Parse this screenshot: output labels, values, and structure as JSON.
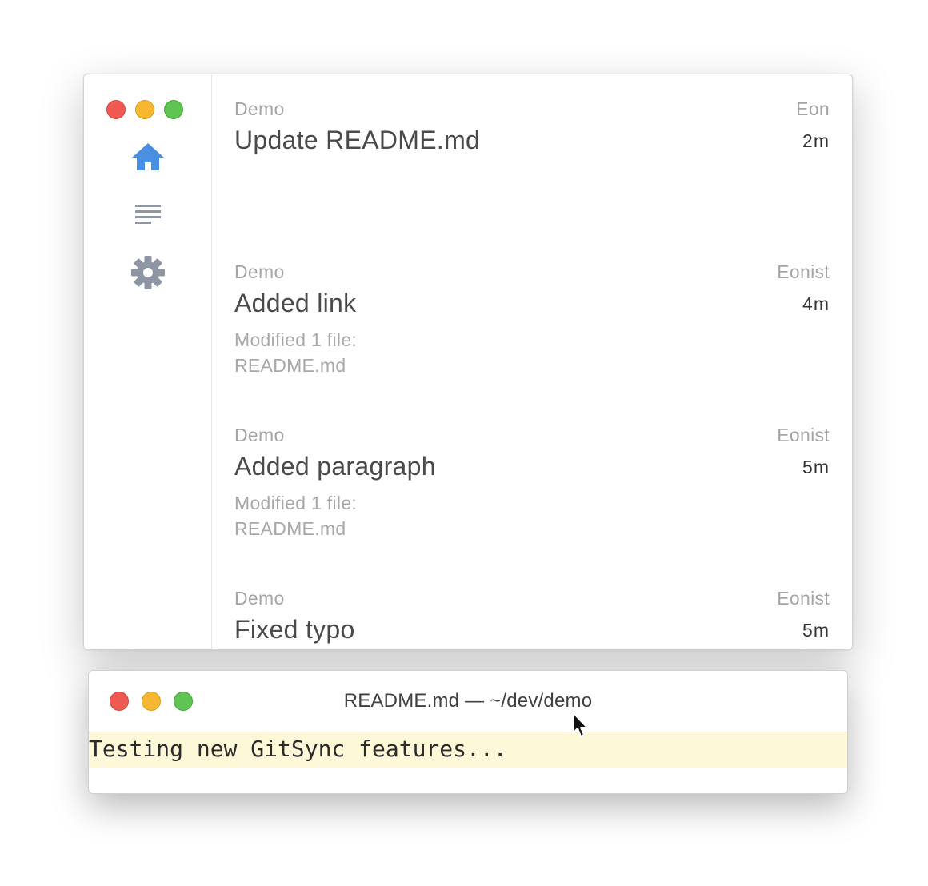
{
  "app": {
    "window_controls": {
      "close": "close-button",
      "minimize": "minimize-button",
      "zoom": "zoom-button"
    },
    "sidebar": {
      "items": [
        {
          "id": "home",
          "icon": "home-icon",
          "active": true,
          "color": "#4a90e2"
        },
        {
          "id": "list",
          "icon": "list-icon",
          "active": false,
          "color": "#8e96a3"
        },
        {
          "id": "settings",
          "icon": "gear-icon",
          "active": false,
          "color": "#8e96a3"
        }
      ]
    },
    "commits": [
      {
        "repo": "Demo",
        "author": "Eon",
        "title": "Update README.md",
        "time": "2m",
        "description": ""
      },
      {
        "repo": "Demo",
        "author": "Eonist",
        "title": "Added link",
        "time": "4m",
        "description": "Modified 1 file:\nREADME.md"
      },
      {
        "repo": "Demo",
        "author": "Eonist",
        "title": "Added paragraph",
        "time": "5m",
        "description": "Modified 1 file:\nREADME.md"
      },
      {
        "repo": "Demo",
        "author": "Eonist",
        "title": "Fixed typo",
        "time": "5m",
        "description": ""
      }
    ]
  },
  "editor": {
    "title": "README.md — ~/dev/demo",
    "line": "Testing new GitSync features...",
    "line_highlight_color": "#fdf9d8"
  },
  "cursor": {
    "icon": "mouse-pointer-icon"
  }
}
